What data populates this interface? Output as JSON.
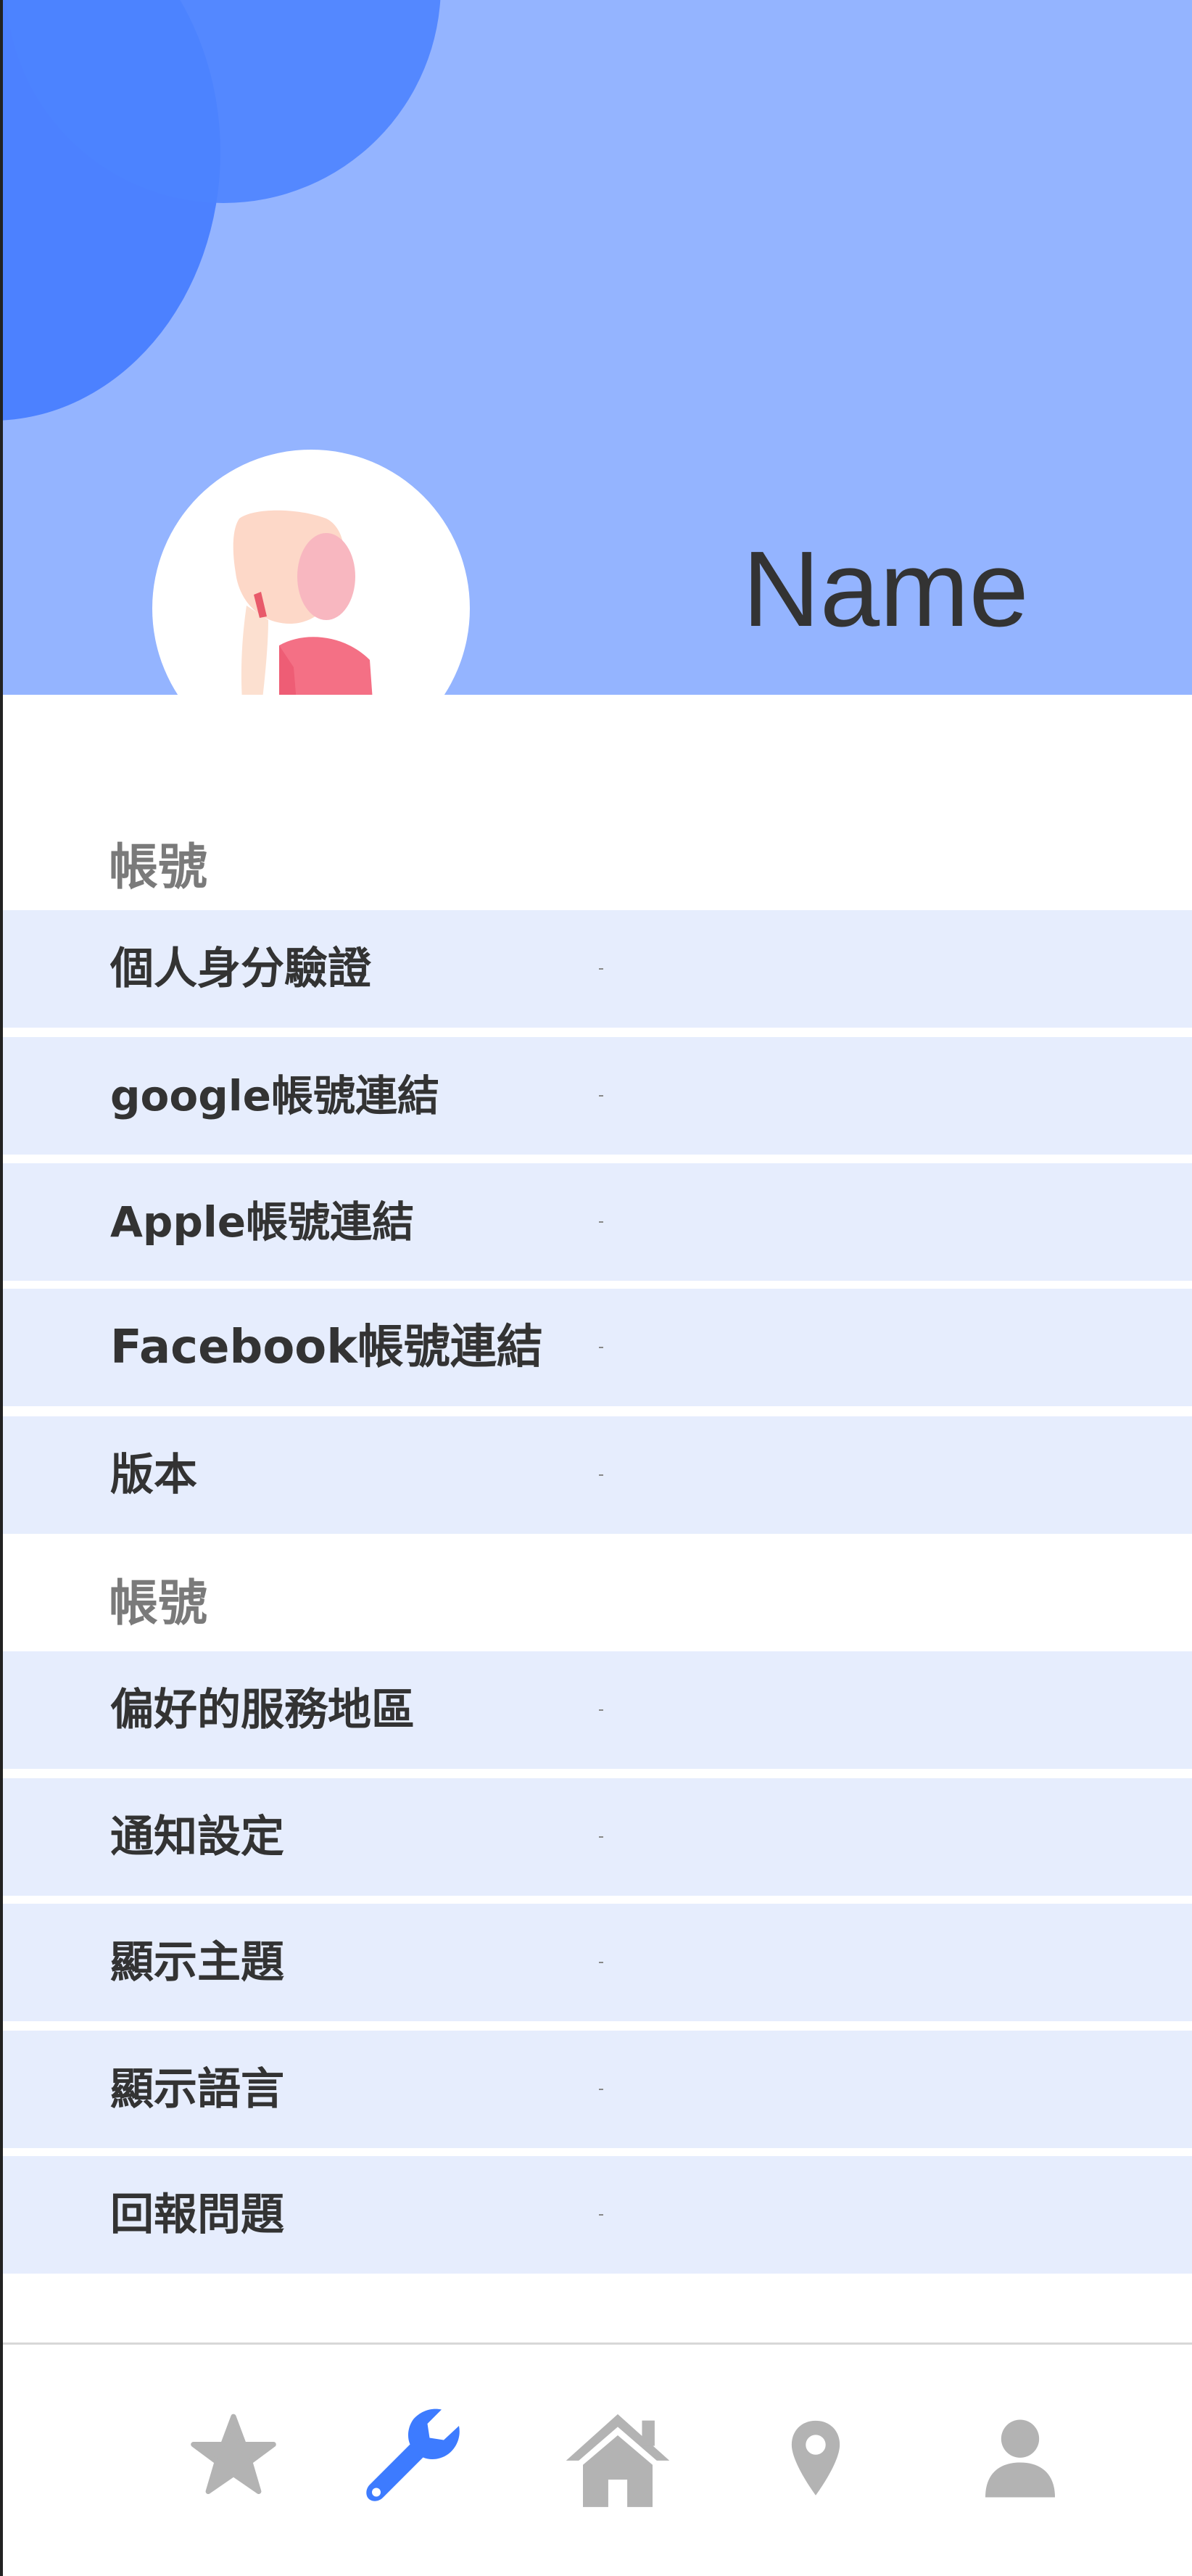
{
  "profile": {
    "name": "Name"
  },
  "sections": [
    {
      "title": "帳號",
      "items": [
        {
          "label": "個人身分驗證"
        },
        {
          "label": "google帳號連結"
        },
        {
          "label": "Apple帳號連結"
        },
        {
          "label": "Facebook帳號連結"
        },
        {
          "label": "版本"
        }
      ]
    },
    {
      "title": "帳號",
      "items": [
        {
          "label": "偏好的服務地區"
        },
        {
          "label": "通知設定"
        },
        {
          "label": "顯示主題"
        },
        {
          "label": "顯示語言"
        },
        {
          "label": "回報問題"
        }
      ]
    }
  ],
  "nav": [
    {
      "icon": "star-icon",
      "active": false
    },
    {
      "icon": "wrench-icon",
      "active": true
    },
    {
      "icon": "home-icon",
      "active": false
    },
    {
      "icon": "location-pin-icon",
      "active": false
    },
    {
      "icon": "person-icon",
      "active": false
    }
  ],
  "colors": {
    "header_bg": "#94b4ff",
    "accent": "#3d7bff",
    "row_bg": "#e6edfd",
    "nav_inactive": "#b3b3b3"
  }
}
